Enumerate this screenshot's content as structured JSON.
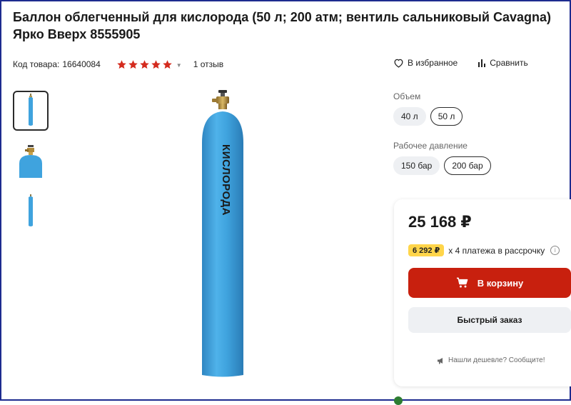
{
  "product": {
    "title": "Баллон облегченный для кислорода (50 л; 200 атм; вентиль сальниковый Cavagna) Ярко Вверх 8555905",
    "code_label": "Код товара:",
    "code_value": "16640084",
    "rating": 5,
    "reviews_label": "1 отзыв",
    "cylinder_text": "КИСЛОРОДА"
  },
  "actions": {
    "favorite_label": "В избранное",
    "compare_label": "Сравнить"
  },
  "options": {
    "volume": {
      "label": "Объем",
      "choices": [
        "40 л",
        "50 л"
      ],
      "selected": "50 л"
    },
    "pressure": {
      "label": "Рабочее давление",
      "choices": [
        "150 бар",
        "200 бар"
      ],
      "selected": "200 бар"
    }
  },
  "purchase": {
    "price": "25 168 ₽",
    "installment_amount": "6 292 ₽",
    "installment_text": "х 4 платежа в рассрочку",
    "cart_button": "В корзину",
    "quick_order_button": "Быстрый заказ",
    "cheaper_link": "Нашли дешевле? Сообщите!"
  },
  "colors": {
    "cylinder_blue": "#3fa3de",
    "cart_red": "#c8200e",
    "star_red": "#d42b1e",
    "badge_yellow": "#ffd54a"
  }
}
